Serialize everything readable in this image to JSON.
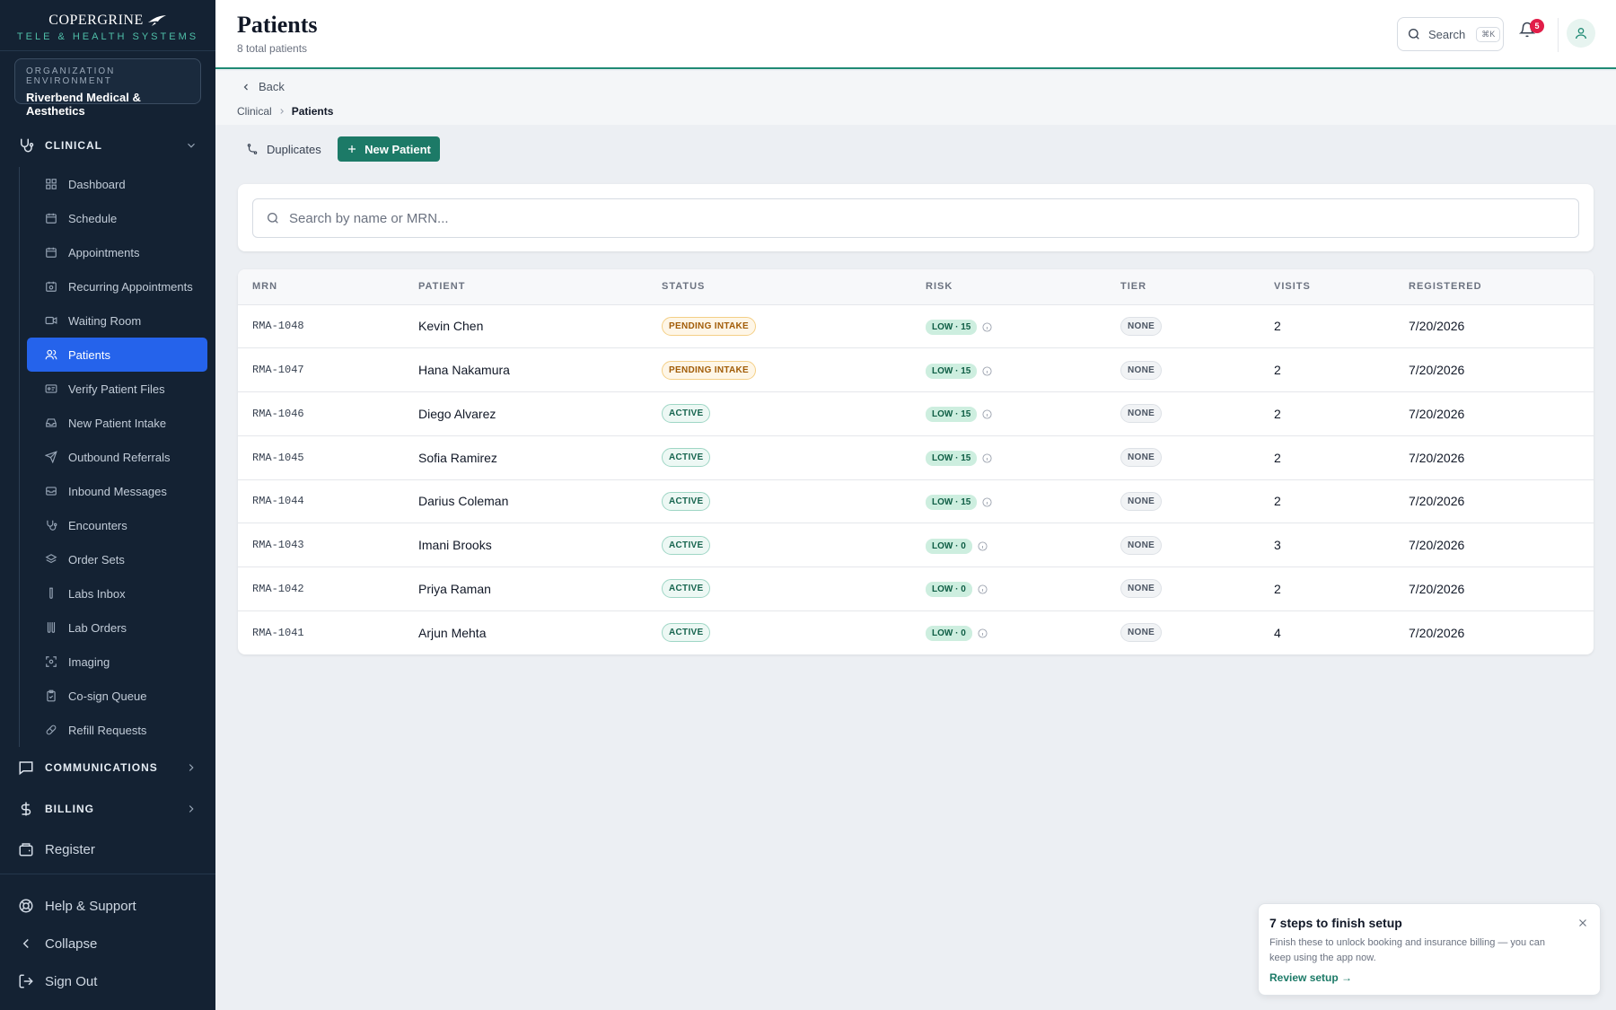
{
  "brand": {
    "name": "COPERGRINE",
    "tagline": "TELE & HEALTH SYSTEMS"
  },
  "org": {
    "label": "ORGANIZATION ENVIRONMENT",
    "name": "Riverbend Medical & Aesthetics"
  },
  "sidebar": {
    "clinical_label": "CLINICAL",
    "items": [
      {
        "label": "Dashboard",
        "icon": "grid-icon"
      },
      {
        "label": "Schedule",
        "icon": "calendar-icon"
      },
      {
        "label": "Appointments",
        "icon": "calendar-icon"
      },
      {
        "label": "Recurring Appointments",
        "icon": "calendar-repeat-icon"
      },
      {
        "label": "Waiting Room",
        "icon": "video-icon"
      },
      {
        "label": "Patients",
        "icon": "users-icon",
        "active": true
      },
      {
        "label": "Verify Patient Files",
        "icon": "id-card-icon"
      },
      {
        "label": "New Patient Intake",
        "icon": "inbox-icon"
      },
      {
        "label": "Outbound Referrals",
        "icon": "send-icon"
      },
      {
        "label": "Inbound Messages",
        "icon": "message-box-icon"
      },
      {
        "label": "Encounters",
        "icon": "stethoscope-icon"
      },
      {
        "label": "Order Sets",
        "icon": "layers-icon"
      },
      {
        "label": "Labs Inbox",
        "icon": "test-tube-icon"
      },
      {
        "label": "Lab Orders",
        "icon": "test-tubes-icon"
      },
      {
        "label": "Imaging",
        "icon": "scan-icon"
      },
      {
        "label": "Co-sign Queue",
        "icon": "clipboard-check-icon"
      },
      {
        "label": "Refill Requests",
        "icon": "pill-icon"
      }
    ],
    "communications_label": "COMMUNICATIONS",
    "billing_label": "BILLING",
    "register_label": "Register",
    "help_label": "Help & Support",
    "collapse_label": "Collapse",
    "signout_label": "Sign Out"
  },
  "header": {
    "title": "Patients",
    "subtitle": "8 total patients",
    "search_label": "Search",
    "search_shortcut": "⌘K",
    "notification_count": "5"
  },
  "nav": {
    "back_label": "Back",
    "breadcrumb_root": "Clinical",
    "breadcrumb_current": "Patients"
  },
  "actions": {
    "duplicates_label": "Duplicates",
    "new_patient_label": "New Patient"
  },
  "search": {
    "placeholder": "Search by name or MRN..."
  },
  "table": {
    "columns": [
      "MRN",
      "PATIENT",
      "STATUS",
      "RISK",
      "TIER",
      "VISITS",
      "REGISTERED"
    ],
    "rows": [
      {
        "mrn": "RMA-1048",
        "patient": "Kevin Chen",
        "status": "PENDING INTAKE",
        "status_kind": "pending",
        "risk": "LOW · 15",
        "tier": "NONE",
        "visits": "2",
        "registered": "7/20/2026"
      },
      {
        "mrn": "RMA-1047",
        "patient": "Hana Nakamura",
        "status": "PENDING INTAKE",
        "status_kind": "pending",
        "risk": "LOW · 15",
        "tier": "NONE",
        "visits": "2",
        "registered": "7/20/2026"
      },
      {
        "mrn": "RMA-1046",
        "patient": "Diego Alvarez",
        "status": "ACTIVE",
        "status_kind": "active",
        "risk": "LOW · 15",
        "tier": "NONE",
        "visits": "2",
        "registered": "7/20/2026"
      },
      {
        "mrn": "RMA-1045",
        "patient": "Sofia Ramirez",
        "status": "ACTIVE",
        "status_kind": "active",
        "risk": "LOW · 15",
        "tier": "NONE",
        "visits": "2",
        "registered": "7/20/2026"
      },
      {
        "mrn": "RMA-1044",
        "patient": "Darius Coleman",
        "status": "ACTIVE",
        "status_kind": "active",
        "risk": "LOW · 15",
        "tier": "NONE",
        "visits": "2",
        "registered": "7/20/2026"
      },
      {
        "mrn": "RMA-1043",
        "patient": "Imani Brooks",
        "status": "ACTIVE",
        "status_kind": "active",
        "risk": "LOW · 0",
        "tier": "NONE",
        "visits": "3",
        "registered": "7/20/2026"
      },
      {
        "mrn": "RMA-1042",
        "patient": "Priya Raman",
        "status": "ACTIVE",
        "status_kind": "active",
        "risk": "LOW · 0",
        "tier": "NONE",
        "visits": "2",
        "registered": "7/20/2026"
      },
      {
        "mrn": "RMA-1041",
        "patient": "Arjun Mehta",
        "status": "ACTIVE",
        "status_kind": "active",
        "risk": "LOW · 0",
        "tier": "NONE",
        "visits": "4",
        "registered": "7/20/2026"
      }
    ]
  },
  "setup_toast": {
    "title": "7 steps to finish setup",
    "body": "Finish these to unlock booking and insurance billing — you can keep using the app now.",
    "link": "Review setup →"
  },
  "colors": {
    "sidebar_bg": "#142233",
    "accent": "#1c7a67",
    "active_nav": "#2563eb",
    "badge": "#e11d48"
  }
}
